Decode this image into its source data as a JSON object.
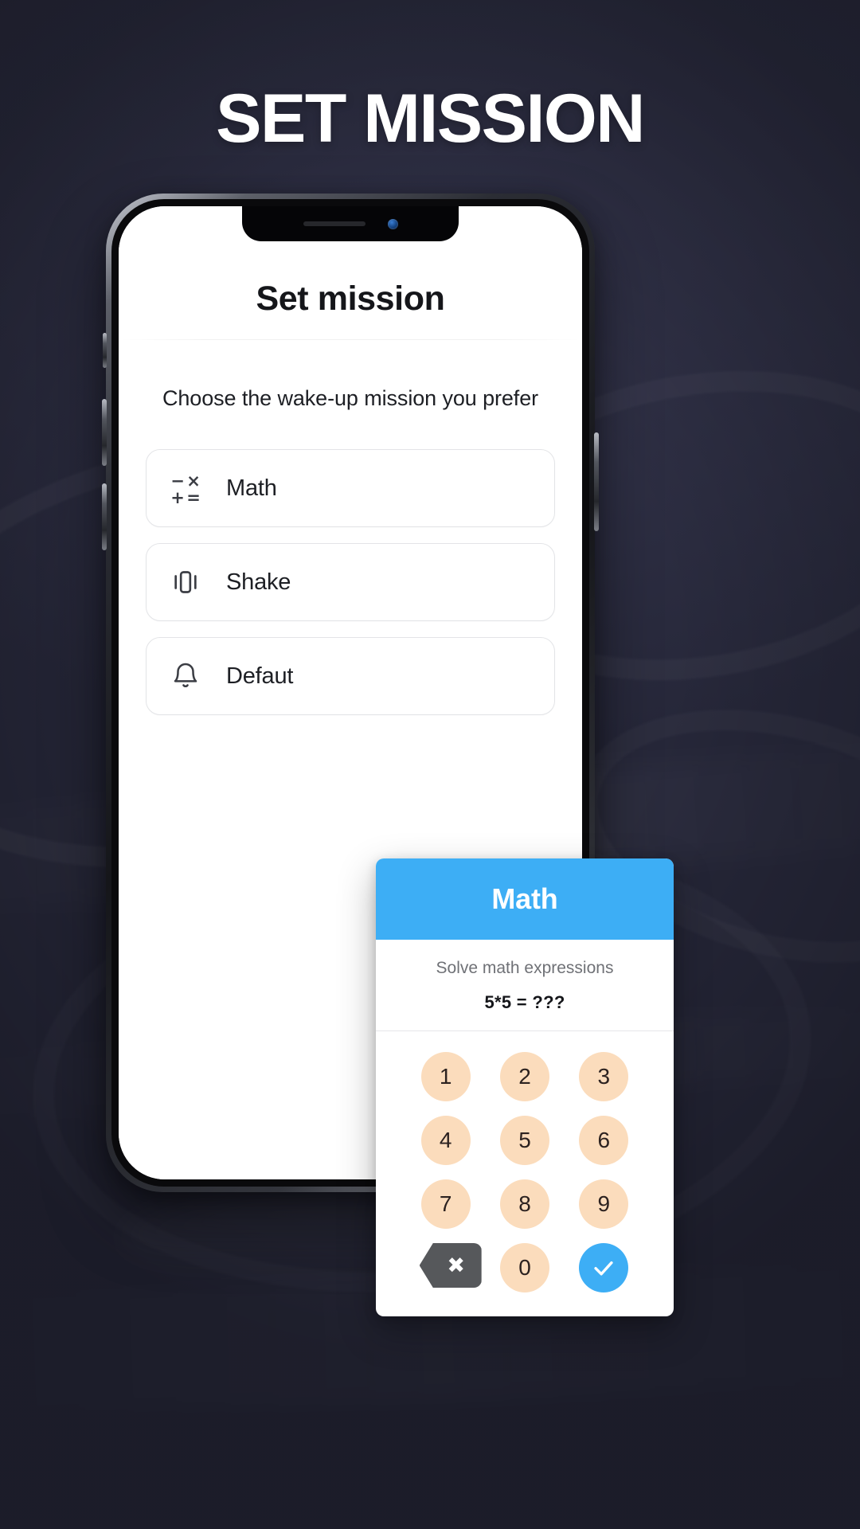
{
  "headline": "SET MISSION",
  "phone": {
    "notch": {
      "speaker_icon": "earpiece-speaker",
      "camera_icon": "front-camera"
    }
  },
  "app": {
    "title": "Set mission",
    "subtitle": "Choose the wake-up mission you prefer",
    "missions": [
      {
        "label": "Math",
        "icon": "math-operators-icon",
        "glyphs": [
          "−",
          "×",
          "+",
          "="
        ]
      },
      {
        "label": "Shake",
        "icon": "shake-phone-icon"
      },
      {
        "label": "Defaut",
        "icon": "bell-icon"
      }
    ]
  },
  "math_dialog": {
    "title": "Math",
    "prompt": "Solve math expressions",
    "expression": "5*5 = ???",
    "keys": [
      "1",
      "2",
      "3",
      "4",
      "5",
      "6",
      "7",
      "8",
      "9"
    ],
    "backspace_label": "backspace",
    "zero_label": "0",
    "confirm_label": "confirm"
  },
  "colors": {
    "accent_blue": "#3DAEF5",
    "key_peach": "#FBDCBC",
    "backspace_gray": "#56585B",
    "background_dark": "#2e2f44",
    "headline_white": "#FFFFFF"
  }
}
